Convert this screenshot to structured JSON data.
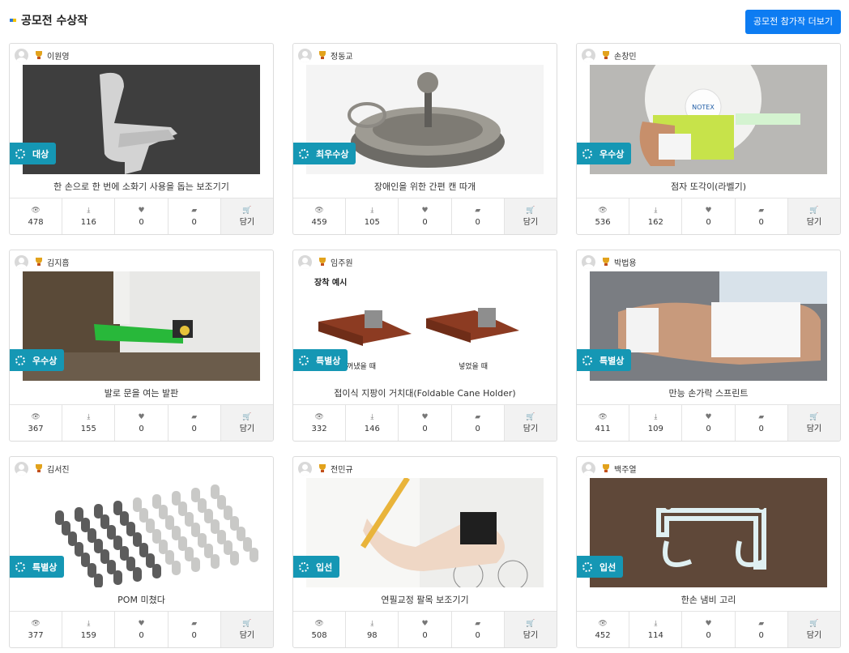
{
  "section_title": "공모전 수상작",
  "more_button": "공모전 참가작 더보기",
  "colors": {
    "accent": "#0d7cf2",
    "award_badge": "#1597b4",
    "title_mark_blue": "#2f79d6",
    "title_mark_yellow": "#f2c200"
  },
  "stat_icons": [
    "eye-icon",
    "download-icon",
    "heart-icon",
    "comment-icon",
    "cart-icon"
  ],
  "cart_label": "담기",
  "cards": [
    {
      "author": "이원영",
      "award": "대상",
      "title": "한 손으로 한 번에 소화기 사용을 돕는 보조기기",
      "views": "478",
      "downloads": "116",
      "likes": "0",
      "comments": "0"
    },
    {
      "author": "정동교",
      "award": "최우수상",
      "title": "장애인을 위한 간편 캔 따개",
      "views": "459",
      "downloads": "105",
      "likes": "0",
      "comments": "0"
    },
    {
      "author": "손창민",
      "award": "우수상",
      "title": "점자 또각이(라벨기)",
      "views": "536",
      "downloads": "162",
      "likes": "0",
      "comments": "0",
      "image_text": "NOTEX"
    },
    {
      "author": "김지흠",
      "award": "우수상",
      "title": "발로 문을 여는 발판",
      "views": "367",
      "downloads": "155",
      "likes": "0",
      "comments": "0"
    },
    {
      "author": "임주원",
      "award": "특별상",
      "title": "접이식 지팡이 거치대(Foldable Cane Holder)",
      "views": "332",
      "downloads": "146",
      "likes": "0",
      "comments": "0",
      "image_texts": [
        "장착 예시",
        "꺼냈을 때",
        "넣었을 때"
      ]
    },
    {
      "author": "박법용",
      "award": "특별상",
      "title": "만능 손가락 스프린트",
      "views": "411",
      "downloads": "109",
      "likes": "0",
      "comments": "0"
    },
    {
      "author": "김서진",
      "award": "특별상",
      "title": "POM 미쳤다",
      "views": "377",
      "downloads": "159",
      "likes": "0",
      "comments": "0"
    },
    {
      "author": "전민규",
      "award": "입선",
      "title": "연필교정 팔목 보조기기",
      "views": "508",
      "downloads": "98",
      "likes": "0",
      "comments": "0"
    },
    {
      "author": "백주열",
      "award": "입선",
      "title": "한손 냄비 고리",
      "views": "452",
      "downloads": "114",
      "likes": "0",
      "comments": "0"
    }
  ]
}
